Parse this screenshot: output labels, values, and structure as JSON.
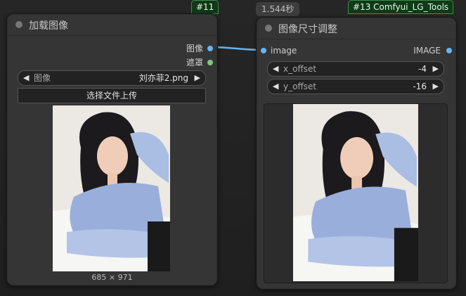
{
  "left_node": {
    "badge": "#11",
    "title": "加载图像",
    "outputs": [
      {
        "label": "图像",
        "color": "#64b5f6"
      },
      {
        "label": "遮罩",
        "color": "#81c784"
      }
    ],
    "image_widget": {
      "label": "图像",
      "value": "刘亦菲2.png"
    },
    "upload_label": "选择文件上传",
    "image_size": "685 × 971"
  },
  "right_node": {
    "time_badge": "1.544秒",
    "badge": "#13 Comfyui_LG_Tools",
    "title": "图像尺寸调整",
    "input": {
      "label": "image",
      "color": "#64b5f6"
    },
    "output": {
      "label": "IMAGE",
      "color": "#64b5f6"
    },
    "widgets": [
      {
        "label": "x_offset",
        "value": "-4"
      },
      {
        "label": "y_offset",
        "value": "-16"
      }
    ]
  },
  "link_color": "#64b5f6",
  "icons": {
    "arrow_left": "◀",
    "arrow_right": "▶"
  }
}
